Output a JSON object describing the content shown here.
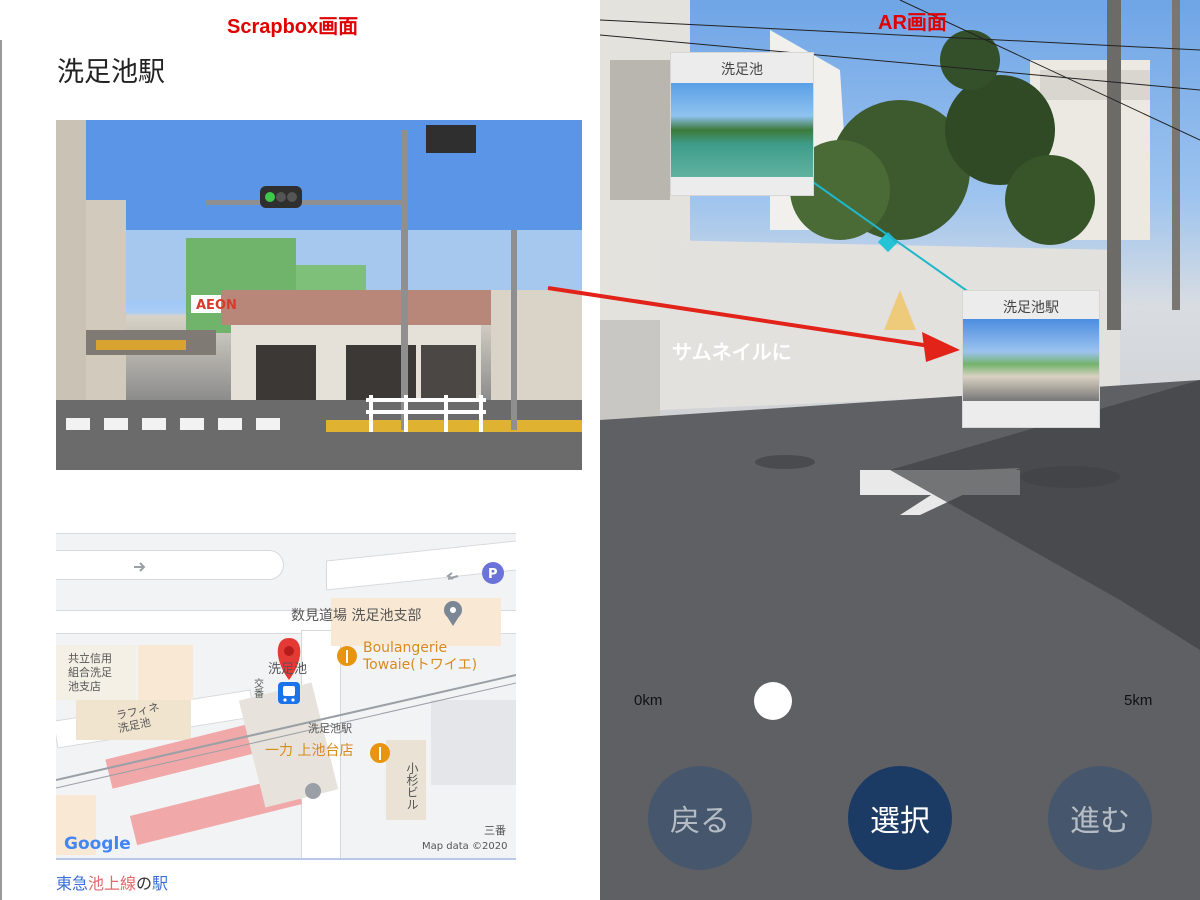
{
  "captions": {
    "left": "Scrapbox画面",
    "right": "AR画面"
  },
  "scrapbox": {
    "page_title": "洗足池駅",
    "photo": {
      "store_sign": "AEON"
    },
    "map": {
      "labels": {
        "dojo": "数見道場 洗足池支部",
        "boulangerie_line1": "Boulangerie",
        "boulangerie_line2": "Towaie(トワイエ)",
        "credit_union_line1": "共立信用",
        "credit_union_line2": "組合洗足",
        "credit_union_line3": "池支店",
        "raffine_line1": "ラフィネ",
        "raffine_line2": "洗足池",
        "station_label": "洗足池",
        "station_small": "洗足池駅",
        "kajita": "一力 上池台店",
        "koban": "交番",
        "komatsu": "小杉ビル",
        "sanban": "三番",
        "google": "Google",
        "map_data": "Map data ©2020"
      },
      "colors": {
        "pin": "#e53935",
        "transit": "#1a73e8",
        "poi_orange": "#e8940f",
        "poi_gray": "#7b8794",
        "parking": "#6b73d8"
      }
    },
    "tags": {
      "line_part1": "東急",
      "line_part2": "池上線",
      "connector": "の",
      "station_word": "駅"
    }
  },
  "ar": {
    "thumbnails": [
      {
        "title": "洗足池"
      },
      {
        "title": "洗足池駅"
      }
    ],
    "annotation": "サムネイルに",
    "distance_scale": {
      "left": "0km",
      "right": "5km"
    },
    "buttons": {
      "back": "戻る",
      "select": "選択",
      "forward": "進む"
    },
    "colors": {
      "arrow": "#e2231a",
      "select_button": "#1c3b64",
      "connector_line": "#1fb7c9"
    }
  }
}
